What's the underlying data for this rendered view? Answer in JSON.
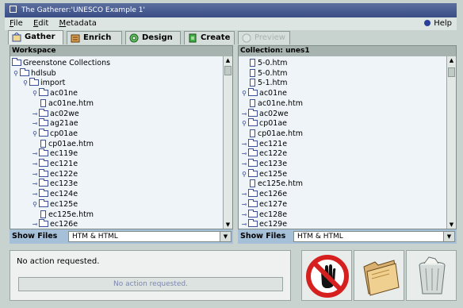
{
  "window": {
    "title": "The Gatherer:'UNESCO Example 1'"
  },
  "menubar": {
    "items": [
      "File",
      "Edit",
      "Metadata"
    ],
    "help": "Help"
  },
  "tabs": [
    {
      "label": "Gather",
      "active": true
    },
    {
      "label": "Enrich"
    },
    {
      "label": "Design"
    },
    {
      "label": "Create"
    },
    {
      "label": "Preview",
      "disabled": true
    }
  ],
  "workspace": {
    "header": "Workspace",
    "tree": [
      {
        "label": "Greenstone Collections",
        "level": 0,
        "type": "folder"
      },
      {
        "label": "hdlsub",
        "level": 0,
        "type": "folder",
        "expander": "open"
      },
      {
        "label": "import",
        "level": 1,
        "type": "folder",
        "expander": "open"
      },
      {
        "label": "ac01ne",
        "level": 2,
        "type": "folder",
        "expander": "open"
      },
      {
        "label": "ac01ne.htm",
        "level": 3,
        "type": "file"
      },
      {
        "label": "ac02we",
        "level": 2,
        "type": "folder",
        "expander": "closed"
      },
      {
        "label": "ag21ae",
        "level": 2,
        "type": "folder",
        "expander": "closed"
      },
      {
        "label": "cp01ae",
        "level": 2,
        "type": "folder",
        "expander": "open"
      },
      {
        "label": "cp01ae.htm",
        "level": 3,
        "type": "file"
      },
      {
        "label": "ec119e",
        "level": 2,
        "type": "folder",
        "expander": "closed"
      },
      {
        "label": "ec121e",
        "level": 2,
        "type": "folder",
        "expander": "closed"
      },
      {
        "label": "ec122e",
        "level": 2,
        "type": "folder",
        "expander": "closed"
      },
      {
        "label": "ec123e",
        "level": 2,
        "type": "folder",
        "expander": "closed"
      },
      {
        "label": "ec124e",
        "level": 2,
        "type": "folder",
        "expander": "closed"
      },
      {
        "label": "ec125e",
        "level": 2,
        "type": "folder",
        "expander": "open"
      },
      {
        "label": "ec125e.htm",
        "level": 3,
        "type": "file"
      },
      {
        "label": "ec126e",
        "level": 2,
        "type": "folder",
        "expander": "closed"
      }
    ],
    "show_files_label": "Show Files",
    "filter_value": "HTM & HTML"
  },
  "collection": {
    "header": "Collection: unes1",
    "tree": [
      {
        "label": "5-0.htm",
        "level": 1,
        "type": "file"
      },
      {
        "label": "5-0.htm",
        "level": 1,
        "type": "file"
      },
      {
        "label": "5-1.htm",
        "level": 1,
        "type": "file"
      },
      {
        "label": "ac01ne",
        "level": 0,
        "type": "folder",
        "expander": "open"
      },
      {
        "label": "ac01ne.htm",
        "level": 1,
        "type": "file"
      },
      {
        "label": "ac02we",
        "level": 0,
        "type": "folder",
        "expander": "closed"
      },
      {
        "label": "cp01ae",
        "level": 0,
        "type": "folder",
        "expander": "open"
      },
      {
        "label": "cp01ae.htm",
        "level": 1,
        "type": "file"
      },
      {
        "label": "ec121e",
        "level": 0,
        "type": "folder",
        "expander": "closed"
      },
      {
        "label": "ec122e",
        "level": 0,
        "type": "folder",
        "expander": "closed"
      },
      {
        "label": "ec123e",
        "level": 0,
        "type": "folder",
        "expander": "closed"
      },
      {
        "label": "ec125e",
        "level": 0,
        "type": "folder",
        "expander": "open"
      },
      {
        "label": "ec125e.htm",
        "level": 1,
        "type": "file"
      },
      {
        "label": "ec126e",
        "level": 0,
        "type": "folder",
        "expander": "closed"
      },
      {
        "label": "ec127e",
        "level": 0,
        "type": "folder",
        "expander": "closed"
      },
      {
        "label": "ec128e",
        "level": 0,
        "type": "folder",
        "expander": "closed"
      },
      {
        "label": "ec129e",
        "level": 0,
        "type": "folder",
        "expander": "closed"
      }
    ],
    "show_files_label": "Show Files",
    "filter_value": "HTM & HTML"
  },
  "status": {
    "message": "No action requested.",
    "progress_text": "No action requested."
  },
  "actions": {
    "stop_icon": "stop-hand-icon",
    "folder_icon": "new-folder-icon",
    "trash_icon": "trash-icon"
  },
  "colors": {
    "title_bar": "#3a4d86",
    "tree_bg": "#eef4f8",
    "show_files_bar": "#a5c0d8",
    "stop_red": "#d62020"
  }
}
